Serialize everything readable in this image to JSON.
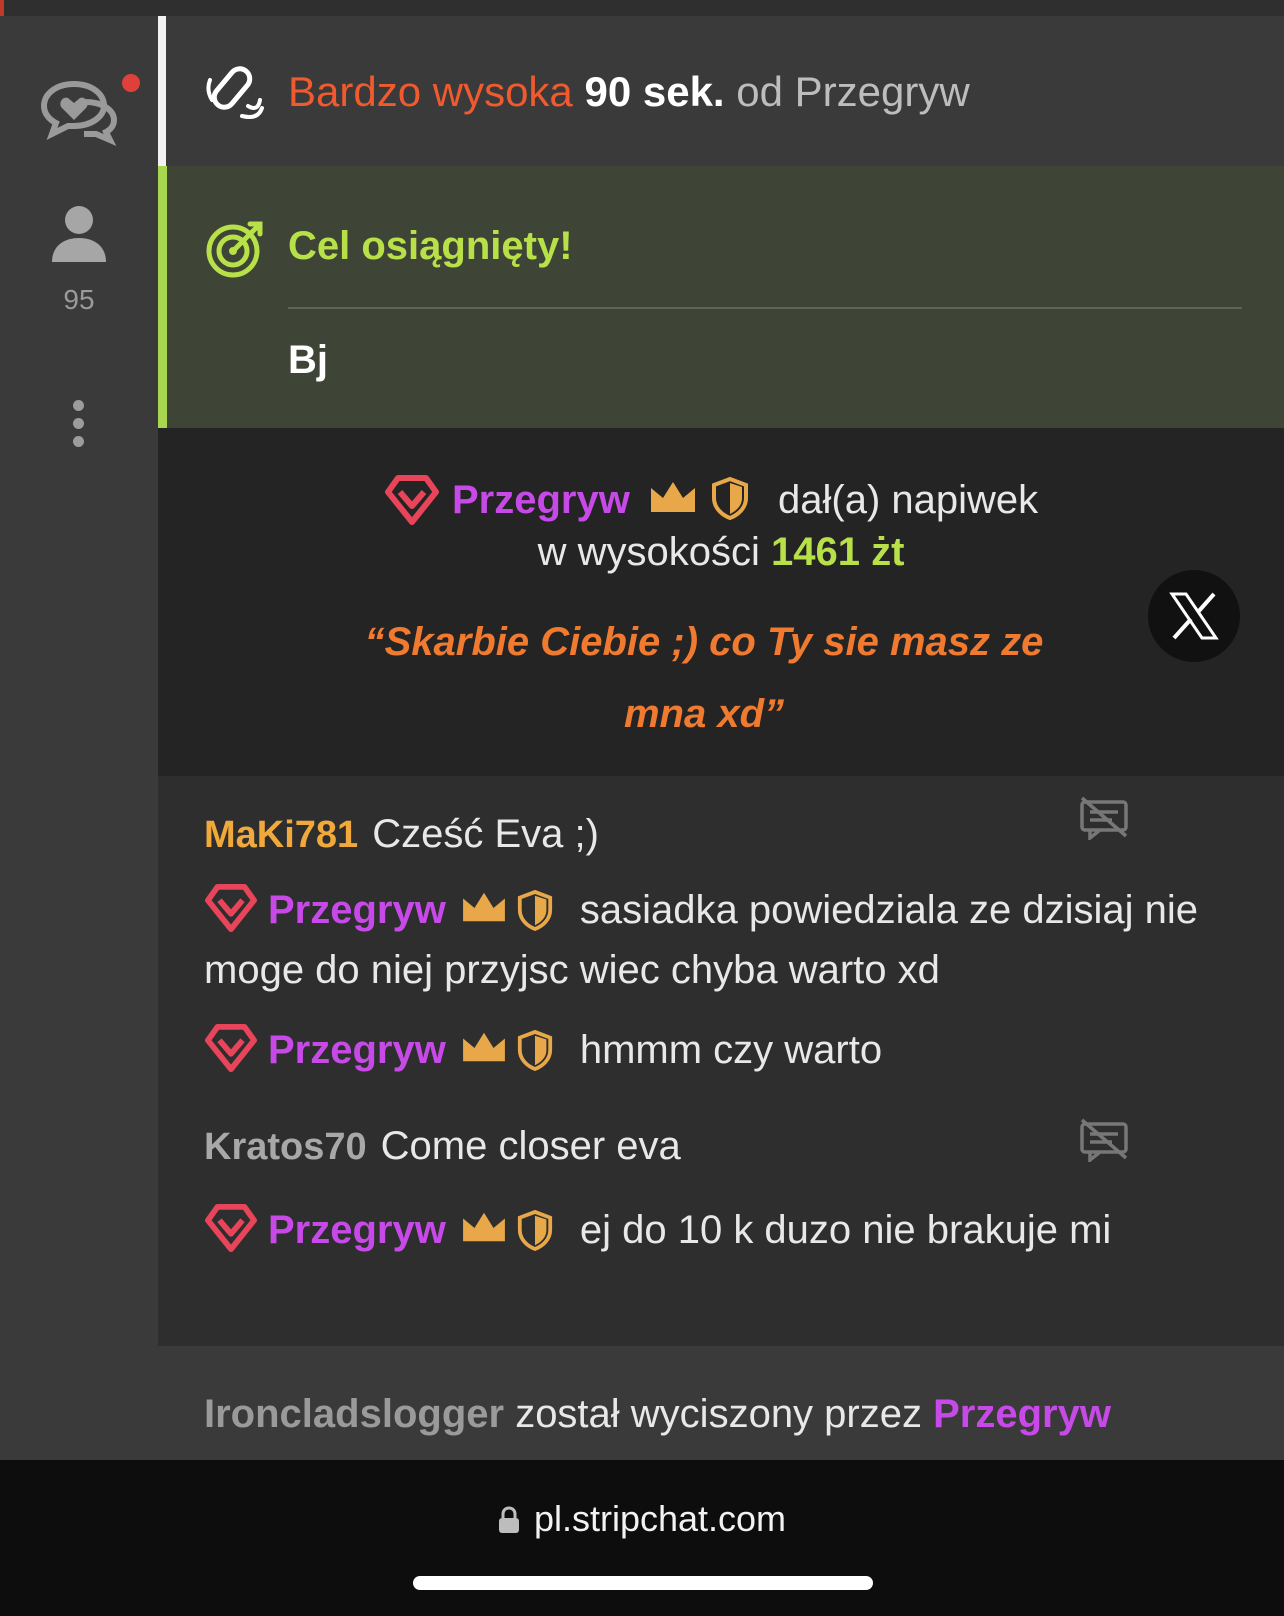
{
  "sidebar": {
    "viewer_count": "95"
  },
  "notice": {
    "level": "Bardzo wysoka",
    "duration": "90 sek.",
    "from": "od Przegryw"
  },
  "goal": {
    "title": "Cel osiągnięty!",
    "subject": "Bj"
  },
  "tip": {
    "username": "Przegryw",
    "gave": "dał(a) napiwek",
    "amount_prefix": "w wysokości",
    "amount": "1461 żt",
    "message": "“Skarbie Ciebie ;) co Ty sie masz ze mna xd”"
  },
  "chat": {
    "messages": [
      {
        "user": "MaKi781",
        "text": "Cześć Eva ;)"
      },
      {
        "user": "Przegryw",
        "text": "sasiadka powiedziala ze dzisiaj nie moge do niej przyjsc wiec chyba warto xd"
      },
      {
        "user": "Przegryw",
        "text": "hmmm czy warto"
      },
      {
        "user": "Kratos70",
        "text": "Come closer eva"
      },
      {
        "user": "Przegryw",
        "text": "ej do 10 k duzo nie brakuje mi"
      }
    ]
  },
  "muted": {
    "user": "Ironcladslogger",
    "text": "został wyciszony przez",
    "by": "Przegryw"
  },
  "browser": {
    "url": "pl.stripchat.com"
  },
  "colors": {
    "accent_orange": "#f05a2e",
    "goal_green": "#b8e048",
    "username_purple": "#c74ae8",
    "tip_text_orange": "#f07a30",
    "badge_gold": "#e8a84a",
    "gem_pink": "#e8445a"
  }
}
